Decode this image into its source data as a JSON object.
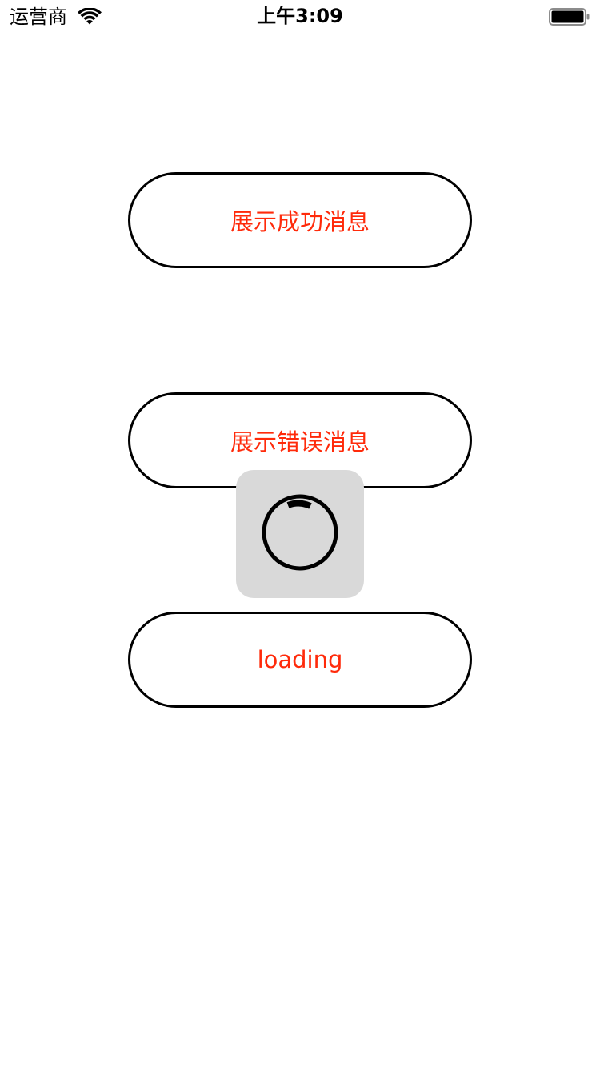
{
  "status_bar": {
    "carrier": "运营商",
    "time": "上午3:09",
    "wifi_icon": "wifi-icon",
    "battery_icon": "battery-full-icon"
  },
  "buttons": {
    "show_success": "展示成功消息",
    "show_error": "展示错误消息",
    "loading": "loading"
  },
  "hud": {
    "icon": "spinner-icon",
    "background": "#d9d9d9"
  },
  "colors": {
    "button_text": "#ff2a0a",
    "button_border": "#000000",
    "background": "#ffffff"
  }
}
